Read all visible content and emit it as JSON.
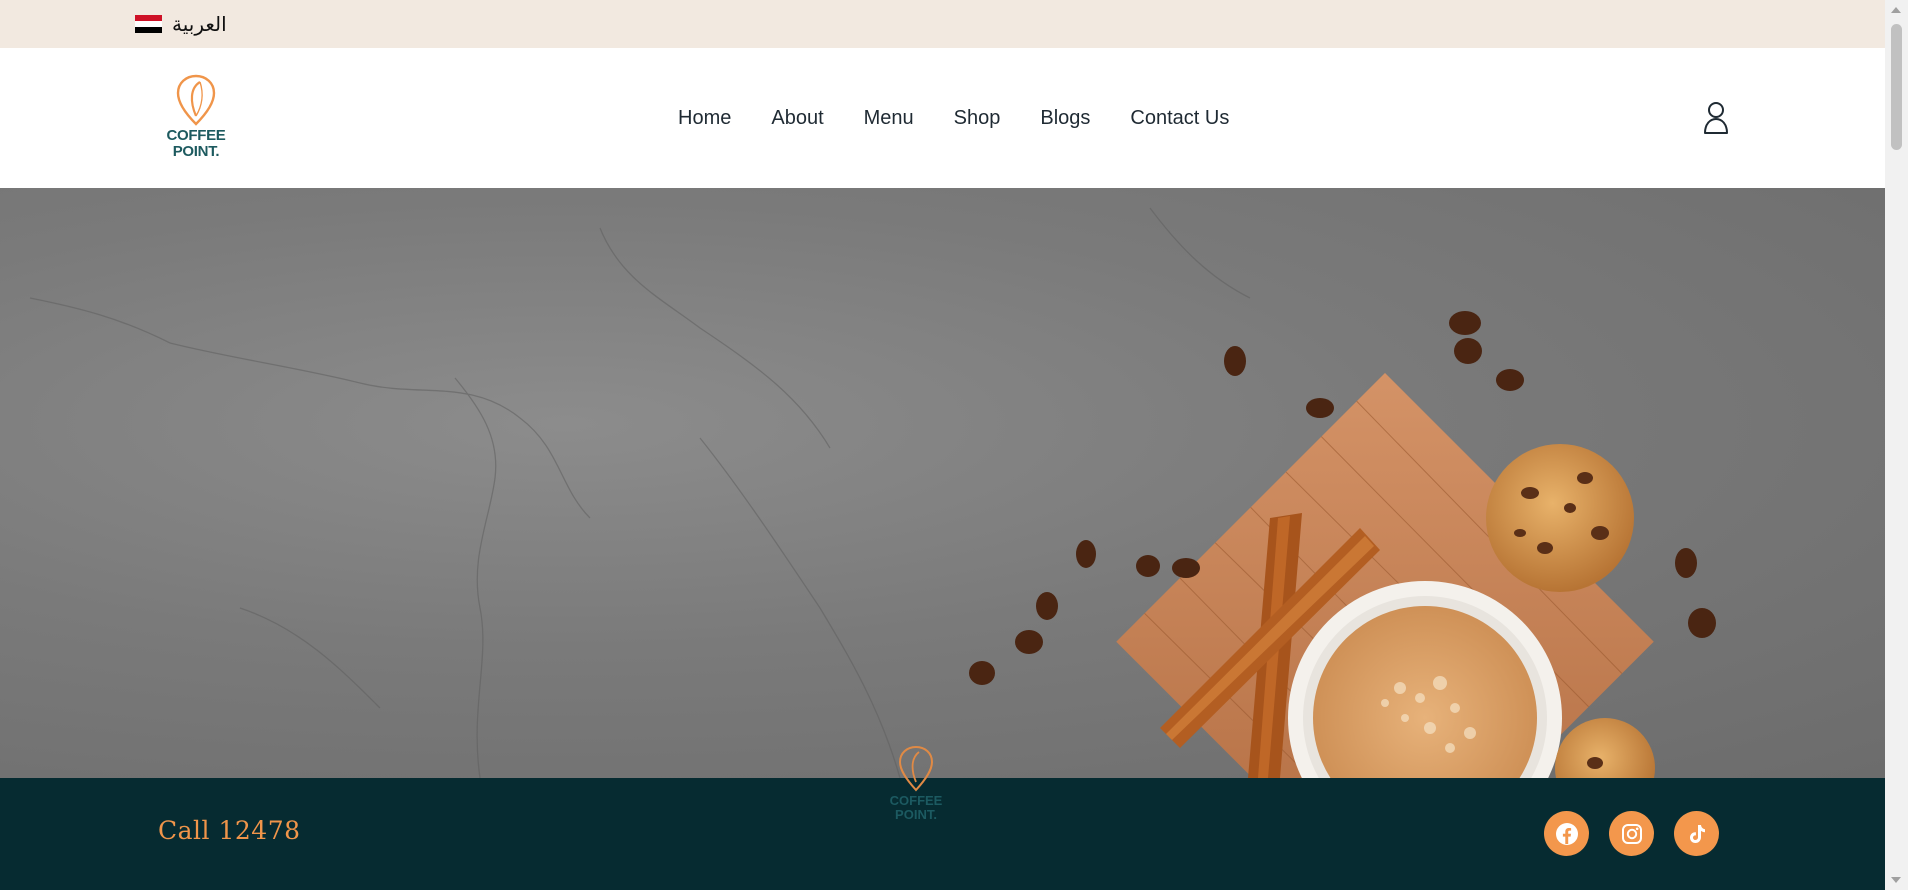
{
  "topbar": {
    "language_label": "العربية",
    "flag_colors": [
      "#ce1126",
      "#ffffff",
      "#000000"
    ]
  },
  "header": {
    "logo": {
      "line1": "COFFEE",
      "line2": "POINT."
    },
    "nav": [
      {
        "label": "Home"
      },
      {
        "label": "About"
      },
      {
        "label": "Menu"
      },
      {
        "label": "Shop"
      },
      {
        "label": "Blogs"
      },
      {
        "label": "Contact Us"
      }
    ],
    "user_icon": "user-icon"
  },
  "hero": {
    "image": "coffee-cup-cinnamon-cookies-on-wooden-board-icon"
  },
  "footer": {
    "call_text": "Call 12478",
    "logo": {
      "line1": "COFFEE",
      "line2": "POINT."
    },
    "socials": [
      {
        "icon": "facebook-icon"
      },
      {
        "icon": "instagram-icon"
      },
      {
        "icon": "tiktok-icon"
      }
    ]
  },
  "colors": {
    "accent": "#f3974c",
    "footer_bg": "#062b31",
    "topbar_bg": "#f2e9e0",
    "logo_teal": "#1d5a5f"
  }
}
